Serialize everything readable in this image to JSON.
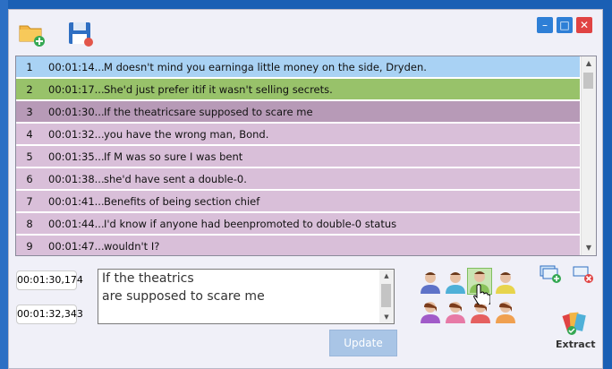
{
  "window_controls": {
    "minimize": "–",
    "maximize": "□",
    "close": "✕"
  },
  "toolbar": {
    "open_icon": "folder-add-icon",
    "save_icon": "save-icon"
  },
  "subtitles": [
    {
      "num": "1",
      "time": "00:01:14...",
      "text": "M doesn't mind you earninga little money on the side, Dryden.",
      "color": "#a9d2f4"
    },
    {
      "num": "2",
      "time": "00:01:17...",
      "text": "She'd just prefer itif it wasn't selling secrets.",
      "color": "#98c26a"
    },
    {
      "num": "3",
      "time": "00:01:30...",
      "text": "If the theatricsare supposed to scare me",
      "color": "#b79ab7"
    },
    {
      "num": "4",
      "time": "00:01:32...",
      "text": "you have the wrong man, Bond.",
      "color": "#d9bfd9"
    },
    {
      "num": "5",
      "time": "00:01:35...",
      "text": "If M was so sure I was bent",
      "color": "#d9bfd9"
    },
    {
      "num": "6",
      "time": "00:01:38...",
      "text": "she'd have sent a double-0.",
      "color": "#d9bfd9"
    },
    {
      "num": "7",
      "time": "00:01:41...",
      "text": "Benefits of being section chief",
      "color": "#d9bfd9"
    },
    {
      "num": "8",
      "time": "00:01:44...",
      "text": "I'd know if anyone had beenpromoted to double-0 status",
      "color": "#d9bfd9"
    },
    {
      "num": "9",
      "time": "00:01:47...",
      "text": "wouldn't I?",
      "color": "#d9bfd9"
    }
  ],
  "editor": {
    "start_time": "00:01:30,174",
    "end_time": "00:01:32,343",
    "line1": "If the theatrics",
    "line2": "are supposed to scare me",
    "update_label": "Update"
  },
  "side_actions": {
    "add_icon": "add-window-icon",
    "remove_icon": "remove-window-icon"
  },
  "extract": {
    "label": "Extract"
  }
}
